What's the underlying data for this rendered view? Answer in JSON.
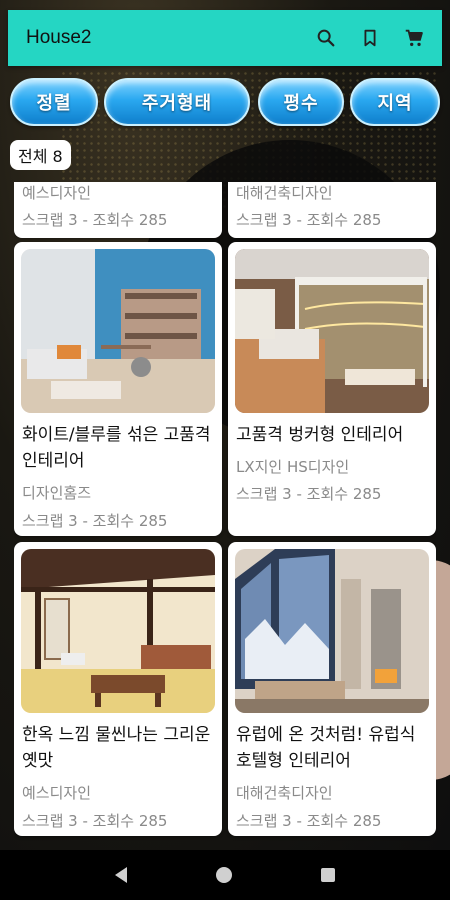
{
  "app_bar": {
    "title": "House2",
    "background": "#25d6c3",
    "icons": [
      "search-icon",
      "bookmark-icon",
      "cart-icon"
    ]
  },
  "filters": [
    {
      "label": "정렬"
    },
    {
      "label": "주거형태"
    },
    {
      "label": "평수"
    },
    {
      "label": "지역"
    }
  ],
  "count_badge": "전체 8",
  "cards": [
    {
      "name": "",
      "designer": "예스디자인",
      "stats": "스크랩 3 - 조회수 285"
    },
    {
      "name": "",
      "designer": "대해건축디자인",
      "stats": "스크랩 3 - 조회수 285"
    },
    {
      "name": "화이트/블루를 섞은 고품격 인테리어",
      "designer": "디자인홈즈",
      "stats": "스크랩 3 - 조회수 285"
    },
    {
      "name": "고품격 벙커형 인테리어",
      "designer": "LX지인 HS디자인",
      "stats": "스크랩 3 - 조회수 285"
    },
    {
      "name": "한옥 느낌 물씬나는 그리운 옛맛",
      "designer": "예스디자인",
      "stats": "스크랩 3 - 조회수 285"
    },
    {
      "name": "유럽에 온 것처럼! 유럽식 호텔형 인테리어",
      "designer": "대해건축디자인",
      "stats": "스크랩 3 - 조회수 285"
    }
  ],
  "nav": [
    "back-icon",
    "home-icon",
    "recents-icon"
  ]
}
